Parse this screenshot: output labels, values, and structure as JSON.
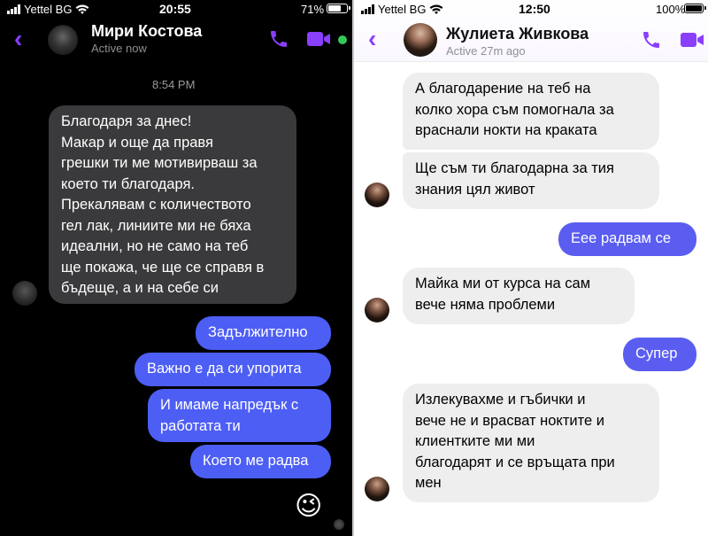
{
  "left": {
    "status": {
      "carrier": "Yettel BG",
      "time": "20:55",
      "battery": "71%",
      "battery_level": 0.71
    },
    "header": {
      "name": "Мири Костова",
      "subtitle": "Active now"
    },
    "timestamp": "8:54 PM",
    "incoming": {
      "lines": [
        "Благодаря за днес!",
        "Макар и още да правя",
        "грешки ти ме мотивирваш за",
        "което ти благодаря.",
        "Прекалявам с количеството",
        "гел лак, линиите ми не бяха",
        "идеални, но не само на теб",
        "ще покажа, че ще се справя в",
        "бъдеще, а и на себе си"
      ]
    },
    "outgoing": [
      {
        "lines": [
          "Задължително"
        ]
      },
      {
        "lines": [
          "Важно е да си упорита"
        ]
      },
      {
        "lines": [
          "И имаме напредък с",
          "работата ти"
        ]
      },
      {
        "lines": [
          "Което ме радва"
        ]
      }
    ],
    "emoji": "😉",
    "colors": {
      "accent": "#8a3ffc",
      "outgoing": "#4d5ef5",
      "incoming": "#3a3a3c",
      "online": "#34c759"
    }
  },
  "right": {
    "status": {
      "carrier": "Yettel BG",
      "time": "12:50",
      "battery": "100%",
      "battery_level": 1.0
    },
    "header": {
      "name": "Жулиета Живкова",
      "subtitle": "Active 27m ago"
    },
    "messages": [
      {
        "dir": "in",
        "lines": [
          "А благодарение на теб на",
          "колко хора съм помогнала за",
          "враснали нокти на краката"
        ]
      },
      {
        "dir": "in",
        "lines": [
          "Ще съм ти благодарна за тия",
          "знания цял живот"
        ]
      },
      {
        "dir": "out",
        "lines": [
          "Еее радвам се"
        ]
      },
      {
        "dir": "in",
        "lines": [
          "Майка ми от курса на сам",
          "вече няма проблеми"
        ]
      },
      {
        "dir": "out",
        "lines": [
          "Супер"
        ]
      },
      {
        "dir": "in",
        "lines": [
          "Излекувахме и гъбички и",
          "вече не и врасват ноктите и",
          "клиентките ми ми",
          "благодарят и се връщата при",
          "мен"
        ]
      }
    ],
    "colors": {
      "accent": "#8a3ffc",
      "outgoing": "#5a5df0",
      "incoming": "#eeeeee"
    }
  }
}
